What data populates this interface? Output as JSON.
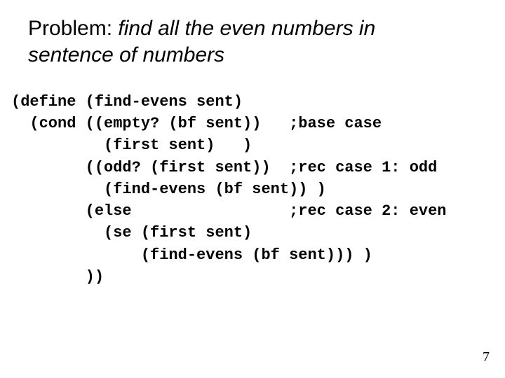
{
  "title": {
    "prefix": "Problem: ",
    "emphasis": "find all the even numbers in sentence of numbers"
  },
  "code": {
    "l1": "(define (find-evens sent)",
    "l2": "  (cond ((empty? (bf sent))   ;base case",
    "l3": "          (first sent)   )",
    "l4": "        ((odd? (first sent))  ;rec case 1: odd",
    "l5": "          (find-evens (bf sent)) )",
    "l6": "        (else                 ;rec case 2: even",
    "l7": "          (se (first sent)",
    "l8": "              (find-evens (bf sent))) )",
    "l9": "        ))"
  },
  "page_number": "7"
}
